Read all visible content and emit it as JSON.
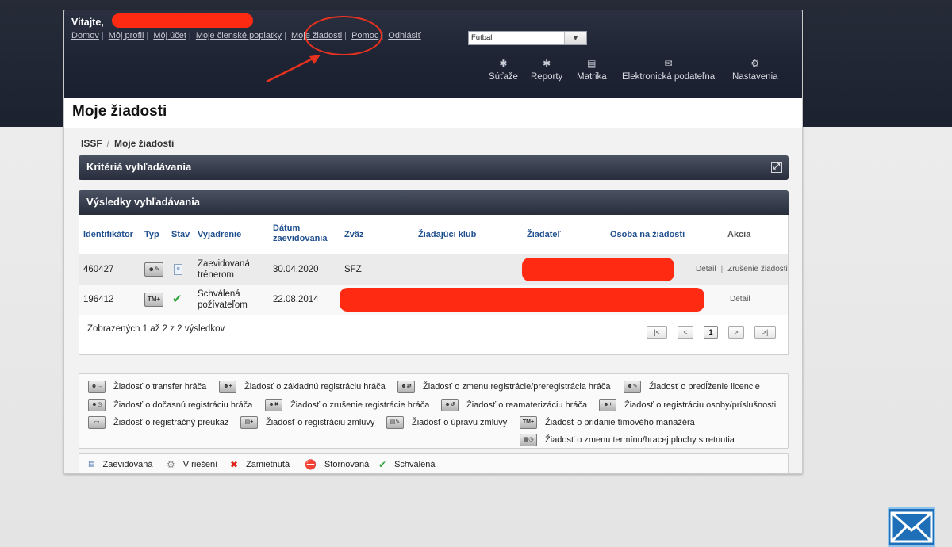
{
  "header": {
    "welcome": "Vitajte, ",
    "nav": [
      {
        "label": "Domov"
      },
      {
        "label": "Môj profil"
      },
      {
        "label": "Môj účet"
      },
      {
        "label": "Moje členské poplatky"
      },
      {
        "label": "Moje žiadosti"
      },
      {
        "label": "Pomoc"
      },
      {
        "label": "Odhlásiť"
      }
    ],
    "sport_selected": "Futbal",
    "tools": [
      {
        "label": "Súťaže",
        "icon": "puzzle-icon"
      },
      {
        "label": "Reporty",
        "icon": "puzzle-icon"
      },
      {
        "label": "Matrika",
        "icon": "registry-icon"
      },
      {
        "label": "Elektronická podateľna",
        "icon": "envelope-icon"
      },
      {
        "label": "Nastavenia",
        "icon": "gear-icon"
      }
    ]
  },
  "page": {
    "title": "Moje žiadosti",
    "breadcrumb": [
      "ISSF",
      "/",
      "Moje žiadosti"
    ]
  },
  "criteria": {
    "title": "Kritériá vyhľadávania"
  },
  "results": {
    "title": "Výsledky vyhľadávania",
    "columns": [
      "Identifikátor",
      "Typ",
      "Stav",
      "Vyjadrenie",
      "Dátum zaevidovania",
      "Zväz",
      "Žiadajúci klub",
      "Žiadateľ",
      "Osoba na žiadosti",
      "Akcia"
    ],
    "rows": [
      {
        "id": "460427",
        "type_icon": "license-renewal-icon",
        "status_icon": "registered-doc-icon",
        "statement": "Zaevidovaná trénerom",
        "date": "30.04.2020",
        "union": "SFZ",
        "actions": [
          "Detail",
          "|",
          "Zrušenie žiadosti"
        ]
      },
      {
        "id": "196412",
        "type_icon": "team-manager-add-icon",
        "status_icon": "check-icon",
        "statement": "Schválená požívateľom",
        "date": "22.08.2014",
        "union": "",
        "actions": [
          "Detail"
        ]
      }
    ],
    "summary": "Zobrazených 1 až 2 z 2 výsledkov",
    "pager": [
      "|<",
      "<",
      "1",
      ">",
      ">|"
    ]
  },
  "legend": [
    "Žiadosť o transfer hráča",
    "Žiadosť o základnú registráciu hráča",
    "Žiadosť o zmenu registrácie/preregistrácia hráča",
    "Žiadosť o predĺženie licencie",
    "Žiadosť o dočasnú registráciu hráča",
    "Žiadosť o zrušenie registrácie hráča",
    "Žiadosť o reamaterizáciu hráča",
    "Žiadosť o registráciu osoby/príslušnosti",
    "Žiadosť o registračný preukaz",
    "Žiadosť o registráciu zmluvy",
    "Žiadosť o úpravu zmluvy",
    "Žiadosť o pridanie tímového manažéra",
    "Žiadosť o zmenu termínu/hracej plochy stretnutia"
  ],
  "status_legend": [
    {
      "label": "Zaevidovaná",
      "icon": "registered-doc-icon"
    },
    {
      "label": "V riešení",
      "icon": "gear-icon"
    },
    {
      "label": "Zamietnutá",
      "icon": "red-x-icon"
    },
    {
      "label": "Stornovaná",
      "icon": "stop-icon"
    },
    {
      "label": "Schválená",
      "icon": "check-icon"
    }
  ],
  "colors": {
    "redaction": "#ff2a12",
    "header_bg": "#1e2433",
    "link_blue": "#1f4f8f",
    "annotation_red": "#e8321f"
  }
}
